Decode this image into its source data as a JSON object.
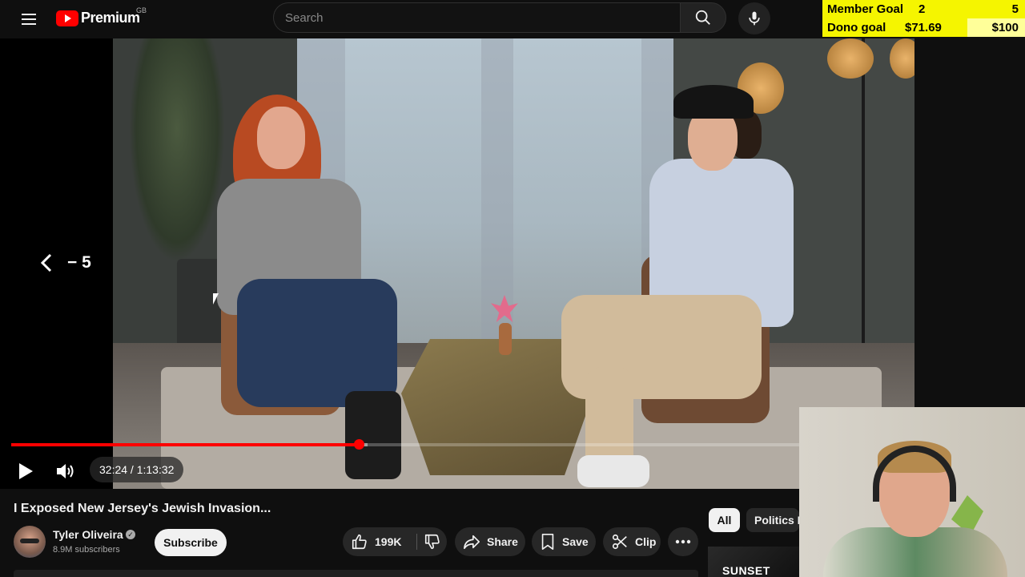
{
  "header": {
    "logo_text": "Premium",
    "country_code": "GB",
    "search_placeholder": "Search"
  },
  "goal_overlay": {
    "member_label": "Member Goal",
    "member_current": "2",
    "member_target": "5",
    "dono_label": "Dono goal",
    "dono_current": "$71.69",
    "dono_target": "$100"
  },
  "player": {
    "seek_hint": "− 5",
    "time_display": "32:24 / 1:13:32",
    "progress_fraction": 0.4407,
    "buffered_fraction": 0.4525
  },
  "video": {
    "title": "I Exposed New Jersey's Jewish Invasion..."
  },
  "channel": {
    "name": "Tyler Oliveira",
    "subscribers": "8.9M subscribers",
    "subscribe_label": "Subscribe"
  },
  "actions": {
    "like_count": "199K",
    "share_label": "Share",
    "save_label": "Save",
    "clip_label": "Clip"
  },
  "chips": {
    "all": "All",
    "politics": "Politics N"
  },
  "recommendation": {
    "thumb_text": "SUNSET"
  },
  "colors": {
    "accent_red": "#ff0000",
    "goal_yellow": "#f5f500",
    "background": "#0f0f0f"
  },
  "icons": [
    "menu-icon",
    "youtube-logo-icon",
    "search-icon",
    "mic-icon",
    "chevron-left-icon",
    "play-icon",
    "volume-icon",
    "thumbs-up-icon",
    "thumbs-down-icon",
    "share-icon",
    "save-icon",
    "clip-icon",
    "more-icon",
    "verified-icon"
  ]
}
